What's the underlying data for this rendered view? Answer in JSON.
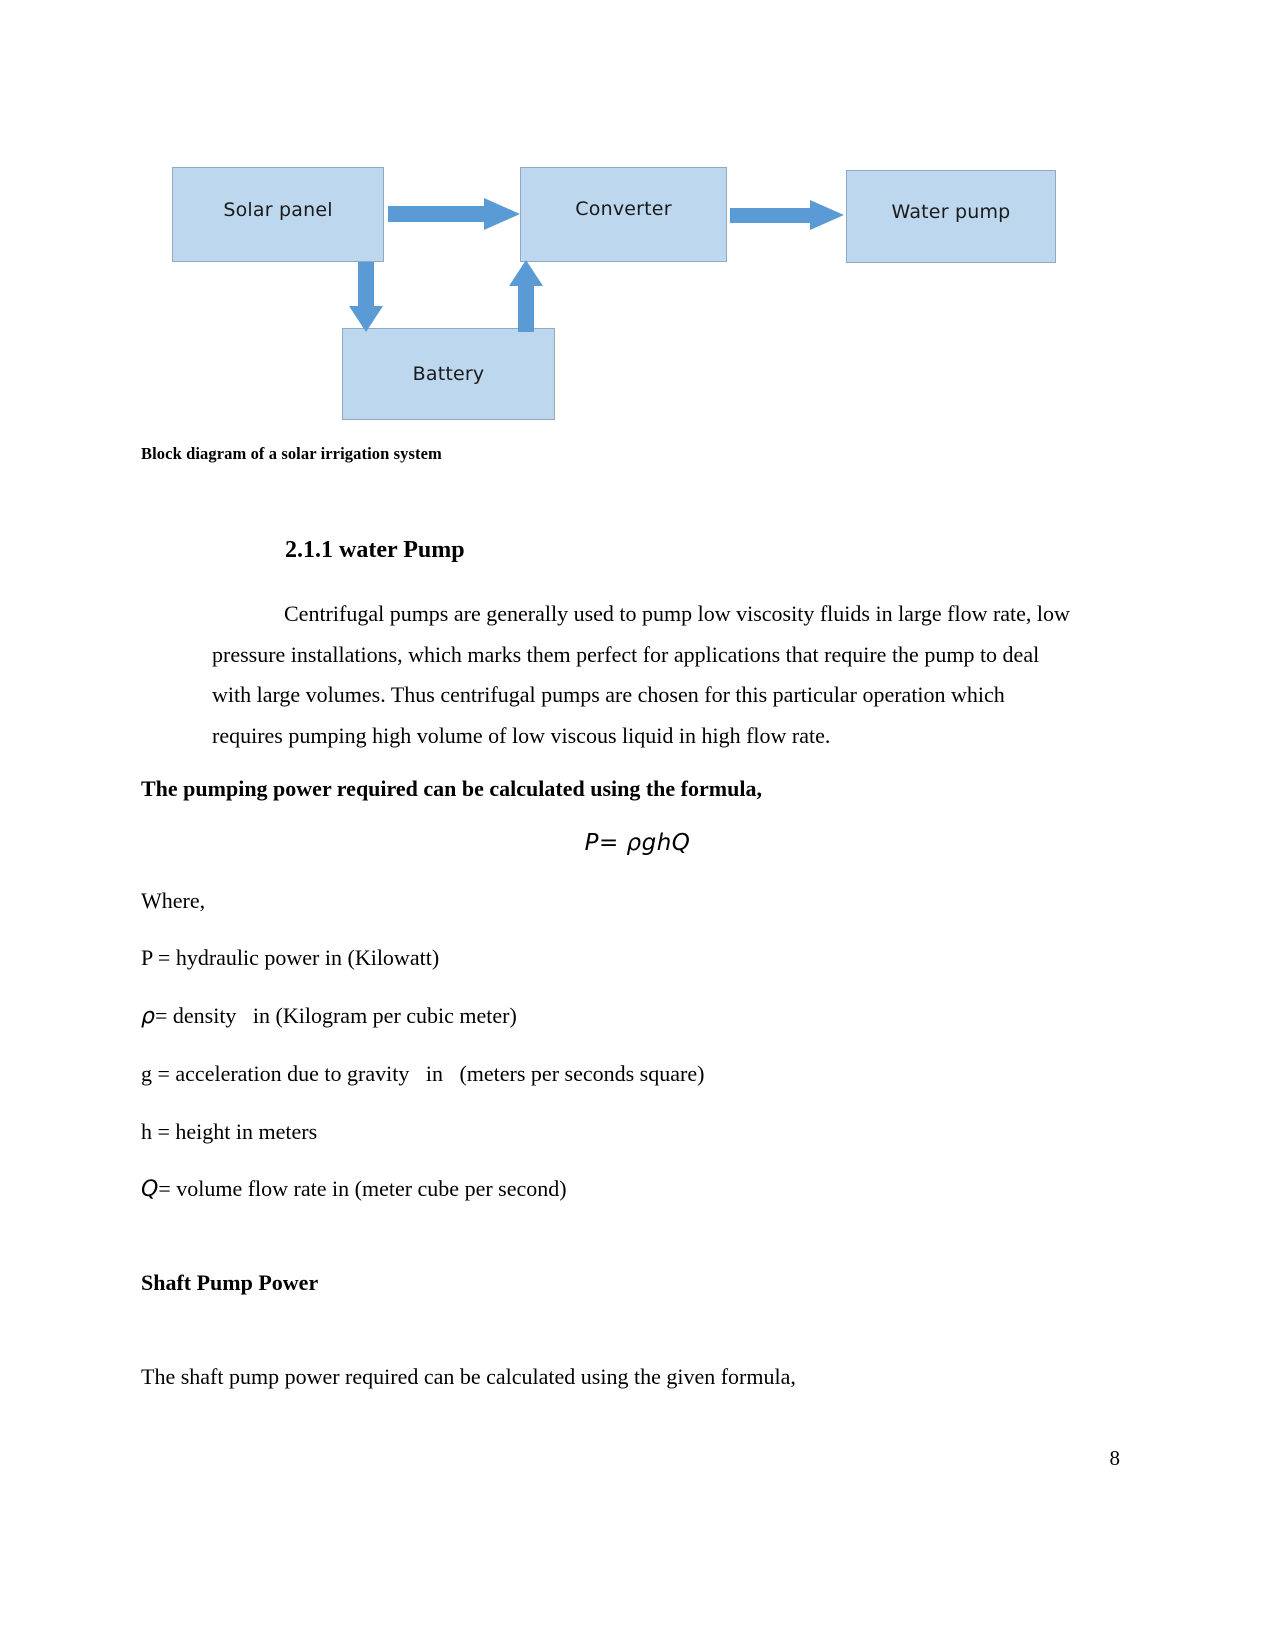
{
  "diagram": {
    "nodes": {
      "solar_panel": "Solar panel",
      "converter": "Converter",
      "water_pump": "Water pump",
      "battery": "Battery"
    },
    "colors": {
      "node_fill": "#bdd7ee",
      "node_border": "#8faac4",
      "arrow": "#5b9bd5"
    }
  },
  "caption": "Block diagram of a solar irrigation system",
  "heading": "2.1.1 water Pump",
  "paragraph": "Centrifugal pumps are generally used to pump low viscosity fluids in large flow rate, low pressure installations, which marks them perfect for applications that require the pump to deal with large volumes. Thus centrifugal pumps are chosen for this particular operation which requires pumping high volume of low viscous liquid in high flow rate.",
  "formula_intro": "The pumping power required can be calculated using the formula,",
  "formula": "P= ρghQ",
  "variables": {
    "where_label": "Where,",
    "p": "P = hydraulic power in (Kilowatt)",
    "rho_symbol": "ρ",
    "rho_rest": "= density   in (Kilogram per cubic meter)",
    "g": "g = acceleration due to gravity   in   (meters per seconds square)",
    "h": "h = height in meters",
    "q_symbol": "Q",
    "q_rest": "= volume flow rate in (meter cube per second)"
  },
  "shaft_heading": "Shaft Pump Power",
  "shaft_intro": "The shaft pump power required can be calculated using the given formula,",
  "page_number": "8"
}
